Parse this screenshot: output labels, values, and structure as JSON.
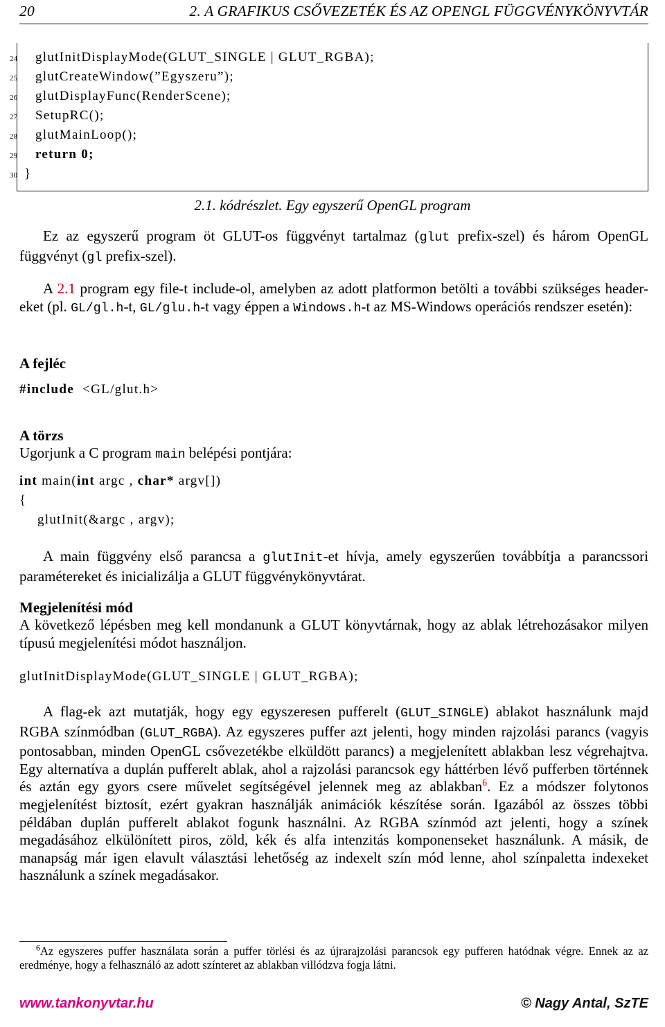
{
  "header": {
    "page_number": "20",
    "chapter_title": "2. A GRAFIKUS CSŐVEZETÉK ÉS AZ OPENGL FÜGGVÉNYKÖNYVTÁR"
  },
  "listing": {
    "rows": [
      {
        "lineno": "24",
        "code": "glutInitDisplayMode(GLUT_SINGLE  |  GLUT_RGBA);",
        "indent": "ind0"
      },
      {
        "lineno": "25",
        "code": "glutCreateWindow(”Egyszeru”);",
        "indent": "ind0"
      },
      {
        "lineno": "26",
        "code": "glutDisplayFunc(RenderScene);",
        "indent": "ind0"
      },
      {
        "lineno": "27",
        "code": "SetupRC();",
        "indent": "ind0"
      },
      {
        "lineno": "28",
        "code": "glutMainLoop();",
        "indent": "ind0"
      },
      {
        "lineno": "29",
        "code": "return  0;",
        "indent": "ind0",
        "bold": true
      },
      {
        "lineno": "30",
        "code": "}",
        "indent": "ind0b"
      }
    ]
  },
  "caption": "2.1. kódrészlet. Egy egyszerű OpenGL program",
  "paragraphs": {
    "p1_a": "Ez az egyszerű program öt GLUT-os függvényt tartalmaz (",
    "p1_mono1": "glut",
    "p1_b": " prefix-szel) és három OpenGL függvényt (",
    "p1_mono2": "gl",
    "p1_c": " prefix-szel).",
    "p2_a": "A ",
    "p2_ref": "2.1",
    "p2_b": " program egy file-t include-ol, amelyben az adott platformon betölti a további szükséges header-eket (pl. ",
    "p2_mono1": "GL/gl.h",
    "p2_c": "-t, ",
    "p2_mono2": "GL/glu.h",
    "p2_d": "-t vagy éppen a ",
    "p2_mono3": "Windows.h",
    "p2_e": "-t az MS-Windows operációs rendszer esetén):",
    "p3_a": "Ugorjunk a C program ",
    "p3_mono1": "main",
    "p3_b": " belépési pontjára:",
    "p4_a": "A main függvény első parancsa a ",
    "p4_mono1": "glutInit",
    "p4_b": "-et hívja, amely egyszerűen továbbítja a parancssori paramétereket és inicializálja a GLUT függvénykönyvtárat.",
    "p5_a": "A következő lépésben meg kell mondanunk a GLUT könyvtárnak, hogy az ablak létrehozásakor milyen típusú megjelenítési módot használjon.",
    "p6_a": "A flag-ek azt mutatják, hogy egy egyszeresen pufferelt (",
    "p6_mono1": "GLUT_SINGLE",
    "p6_b": ") ablakot használunk majd RGBA színmódban (",
    "p6_mono2": "GLUT_RGBA",
    "p6_c": "). Az egyszeres puffer azt jelenti, hogy minden rajzolási parancs (vagyis pontosabban, minden OpenGL csővezetékbe elküldött parancs) a megjelenített ablakban lesz végrehajtva.  Egy alternatíva a duplán pufferelt ablak, ahol a rajzolási parancsok egy háttérben lévő pufferben történnek és aztán egy gyors csere művelet segítségével jelennek meg az ablakban",
    "p6_fnmark": "6",
    "p6_d": ".  Ez a módszer folytonos megjelenítést biztosít, ezért gyakran használják animációk készítése során.  Igazából az összes többi példában duplán pufferelt ablakot fogunk használni.  Az RGBA színmód azt jelenti, hogy a színek megadásához elkülönített piros, zöld, kék és alfa intenzitás komponenseket használunk.  A másik, de manapság már igen elavult választási lehetőség az indexelt szín mód lenne, ahol színpaletta indexeket használunk a színek megadásakor."
  },
  "subheads": {
    "header_label": "A fejléc",
    "body_label": "A törzs",
    "display_mode_label": "Megjelenítési mód"
  },
  "snippets": {
    "include_kw": "#include",
    "include_rest": "<GL/glut.h>",
    "main_kw1": "int",
    "main_mid1": " main(",
    "main_kw2": "int",
    "main_mid2": " argc ,  ",
    "main_kw3": "char*",
    "main_mid3": " argv[])",
    "brace_open": "{",
    "glutinit": "glutInit(&argc ,  argv);",
    "display_mode": "glutInitDisplayMode(GLUT_SINGLE  |  GLUT_RGBA);"
  },
  "footnote": {
    "marker": "6",
    "text": "Az egyszeres puffer használata során a puffer törlési és az újrarajzolási parancsok egy pufferen hatódnak végre. Ennek az az eredménye, hogy a felhasználó az adott színteret az ablakban villódzva fogja látni."
  },
  "footer": {
    "site": "www.tankonyvtar.hu",
    "copyright": "© Nagy Antal, SzTE"
  },
  "colors": {
    "link_red": "#c00000",
    "footer_magenta": "#d6007e",
    "rule_black": "#111111"
  }
}
